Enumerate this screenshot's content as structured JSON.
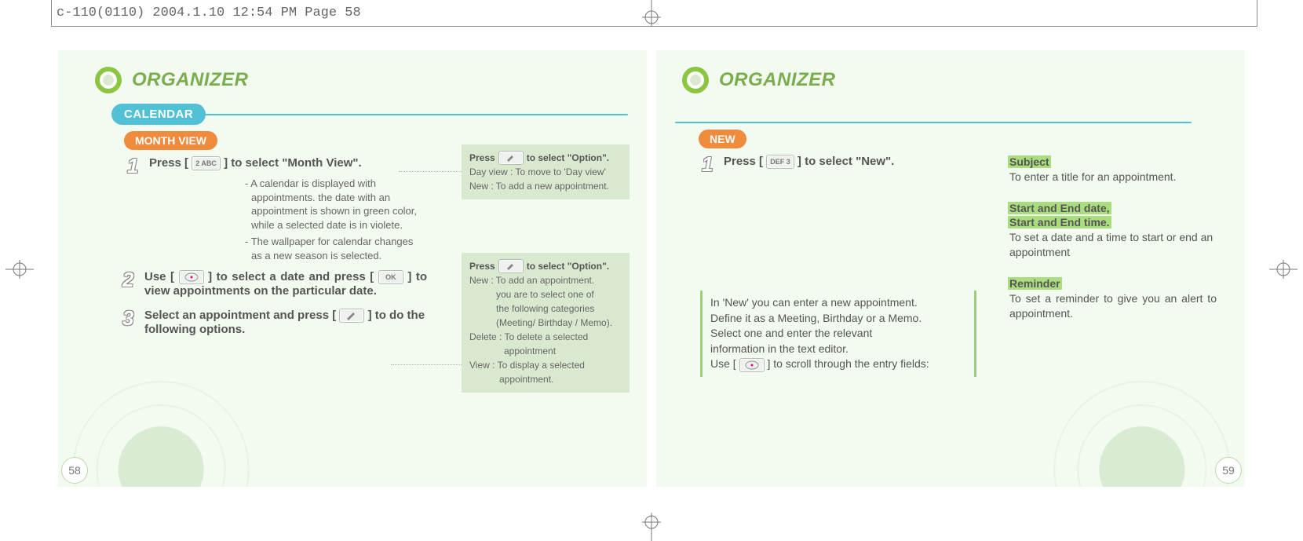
{
  "print_header": "c-110(0110)  2004.1.10  12:54 PM  Page 58",
  "section_title": "ORGANIZER",
  "calendar_label": "CALENDAR",
  "left": {
    "sub_label": "MONTH VIEW",
    "step1_pre": "Press [",
    "step1_key": "2 ABC",
    "step1_post": "] to select \"Month View\".",
    "note_a": "- A calendar is displayed with appointments. the date with an appointment is shown in green color, while a selected date is in violete.",
    "note_b": "- The wallpaper for calendar changes as a new season is selected.",
    "step2_pre": "Use [",
    "step2_mid": "] to select a date and press [",
    "step2_post": "] to view appointments on the particular date.",
    "step2_key2": "OK",
    "step3_pre": "Select an appointment and press [",
    "step3_post": "] to do the following options.",
    "box1_head_pre": "Press",
    "box1_head_post": "to select \"Option\".",
    "box1_l1": "Day view : To move to 'Day view'",
    "box1_l2": "New : To add a new appointment.",
    "box2_head_pre": "Press",
    "box2_head_post": "to select \"Option\".",
    "box2_l1": "New : To add an appointment.",
    "box2_l2": "you are to select one of",
    "box2_l3": "the following categories",
    "box2_l4": "(Meeting/ Birthday / Memo).",
    "box2_l5": "Delete : To delete a selected",
    "box2_l6": "appointment",
    "box2_l7": "View : To display a selected",
    "box2_l8": "appointment.",
    "page_no": "58"
  },
  "right": {
    "sub_label": "NEW",
    "step1_pre": "Press [",
    "step1_key": "DEF 3",
    "step1_post": "] to select \"New\".",
    "info_l1": "In 'New' you can enter a new appointment.",
    "info_l2": "Define it as a Meeting, Birthday or a Memo.",
    "info_l3": "Select one and enter the relevant",
    "info_l4": "information in the text editor.",
    "info_l5_pre": "Use [",
    "info_l5_post": "] to scroll through the entry fields:",
    "fields": {
      "subject_t": "Subject",
      "subject_b": "To enter a title for an appointment.",
      "date_t1": "Start and End date,",
      "date_t2": "Start and End time.",
      "date_b": "To set a date and a time to start or end an appointment",
      "reminder_t": "Reminder",
      "reminder_b": "To set a reminder to give you an alert to appointment."
    },
    "page_no": "59"
  }
}
